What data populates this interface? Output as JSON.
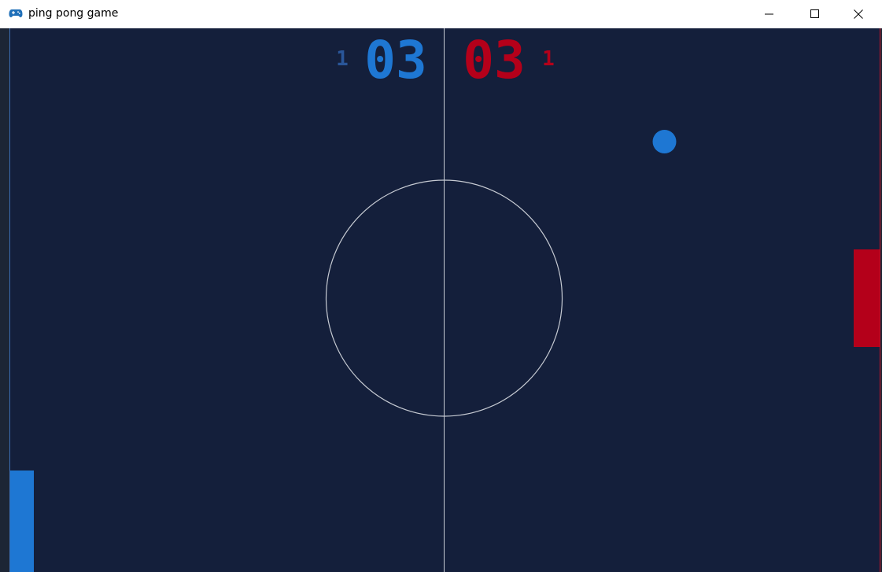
{
  "window": {
    "title": "ping pong game",
    "app_icon": "gamepad-icon",
    "controls": [
      "minimize-icon",
      "maximize-icon",
      "close-icon"
    ]
  },
  "colors": {
    "court": "#141f3b",
    "center_line": "#c7cbd3",
    "player1": "#1e77d3",
    "player1_dim": "#2a5699",
    "player2": "#b4001a",
    "player2_dim": "#8a1022",
    "ball": "#1e77d3"
  },
  "scoreboard": {
    "player1_sets": "1",
    "player1_score": "03",
    "player2_score": "03",
    "player2_sets": "1"
  }
}
